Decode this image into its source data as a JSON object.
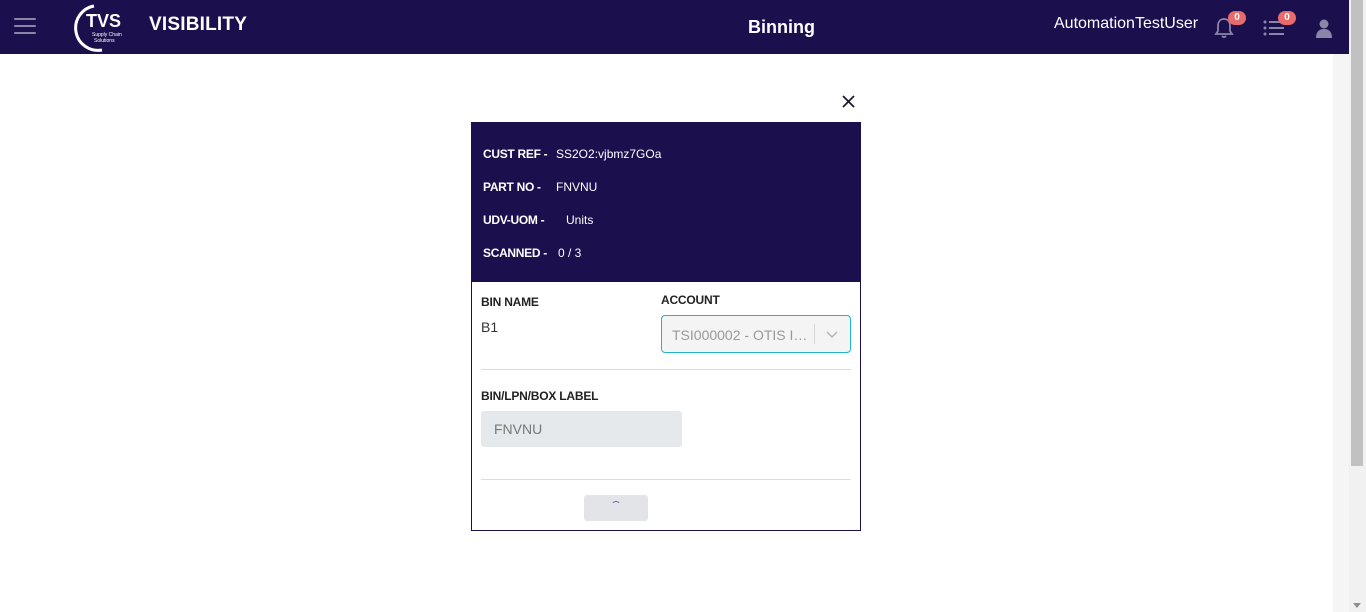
{
  "header": {
    "logo_text": "TVS",
    "logo_subtext": "Supply Chain Solutions",
    "brand": "VISIBILITY",
    "page_title": "Binning",
    "username": "AutomationTestUser",
    "notifications_count": "0",
    "tasks_count": "0"
  },
  "modal": {
    "info": [
      {
        "key": "CUST REF -",
        "value": "SS2O2:vjbmz7GOa"
      },
      {
        "key": "PART NO -",
        "value": "FNVNU"
      },
      {
        "key": "UDV-UOM -",
        "value": "Units"
      },
      {
        "key": "SCANNED -",
        "value": "0 / 3"
      }
    ],
    "bin_name_label": "BIN NAME",
    "bin_name_value": "B1",
    "account_label": "ACCOUNT",
    "account_value": "TSI000002 - OTIS IN...",
    "label_field_label": "BIN/LPN/BOX LABEL",
    "label_field_value": "FNVNU"
  },
  "colors": {
    "nav_bg": "#1b0f4e",
    "badge": "#e86a6a",
    "select_border": "#22b3c7"
  },
  "icons": [
    "menu-icon",
    "notification-bell-icon",
    "task-list-icon",
    "user-icon",
    "close-icon",
    "chevron-down-icon",
    "loading-spinner-icon"
  ]
}
